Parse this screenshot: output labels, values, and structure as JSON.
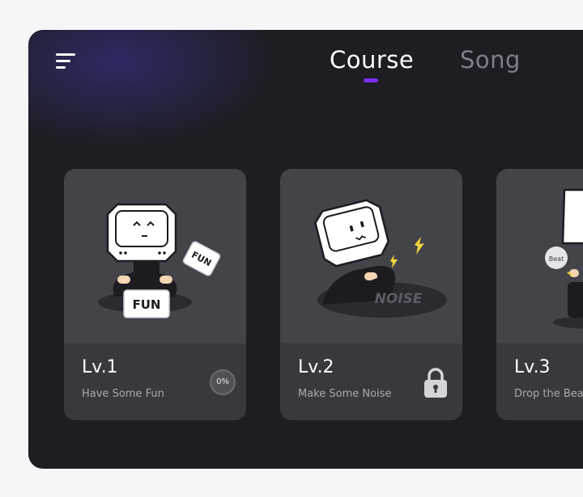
{
  "header": {
    "tabs": [
      {
        "label": "Course",
        "active": true
      },
      {
        "label": "Song",
        "active": false
      }
    ],
    "accent_color": "#7a2ff0"
  },
  "cards": [
    {
      "level": "Lv.1",
      "title": "Have Some Fun",
      "progress": "0%",
      "badge_text": "FUN",
      "sticker_text": "FUN"
    },
    {
      "level": "Lv.2",
      "title": "Make Some Noise",
      "locked": true,
      "lock_icon": "lock-icon",
      "floor_text": "NOISE"
    },
    {
      "level": "Lv.3",
      "title": "Drop the Beat",
      "bubble_text": "Beat"
    }
  ]
}
